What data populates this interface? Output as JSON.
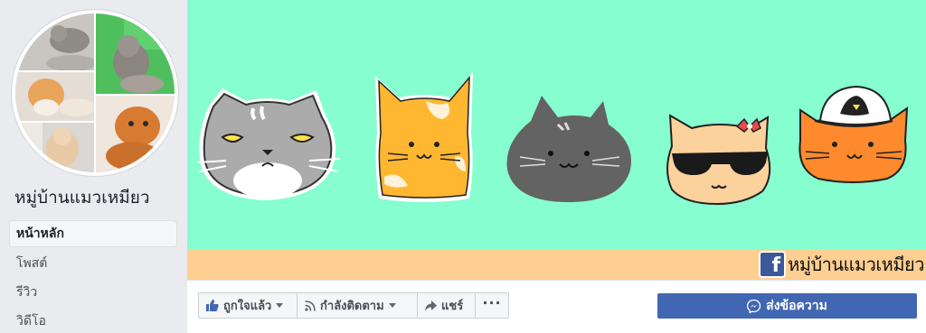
{
  "page": {
    "name": "หมู่บ้านแมวเหมียว"
  },
  "sidebar": {
    "items": [
      {
        "label": "หน้าหลัก",
        "active": true
      },
      {
        "label": "โพสต์",
        "active": false
      },
      {
        "label": "รีวิว",
        "active": false
      },
      {
        "label": "วิดีโอ",
        "active": false
      }
    ]
  },
  "cover": {
    "background_color": "#86fed0",
    "band_color": "#ffcf92",
    "band_text": "หมู่บ้านแมวเหมียว",
    "band_icon": "facebook-icon"
  },
  "actions": {
    "like_label": "ถูกใจแล้ว",
    "follow_label": "กำลังติดตาม",
    "share_label": "แชร์",
    "more_label": "···",
    "message_label": "ส่งข้อความ",
    "message_color": "#4267b2"
  },
  "icons": {
    "like": "thumbs-up-icon",
    "follow": "rss-icon",
    "share": "share-arrow-icon",
    "message": "messenger-icon"
  }
}
